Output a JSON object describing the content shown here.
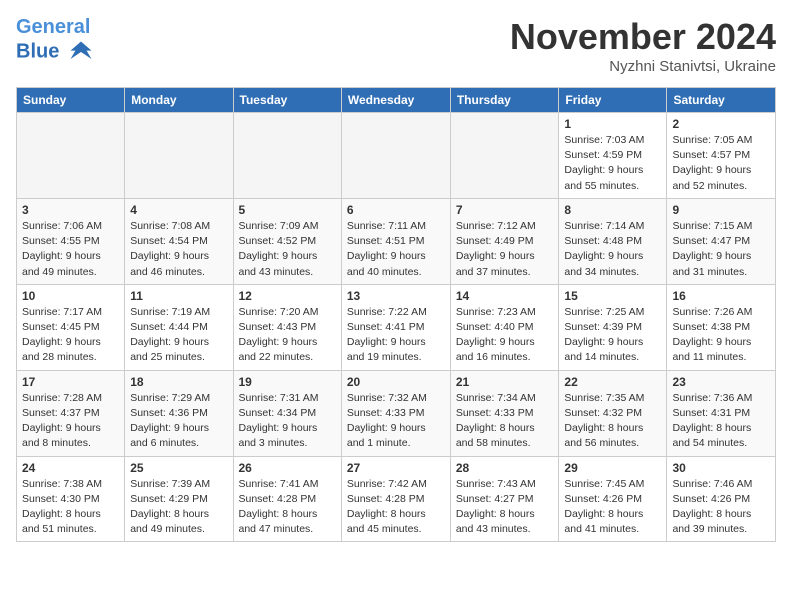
{
  "logo": {
    "line1": "General",
    "line2": "Blue"
  },
  "title": "November 2024",
  "subtitle": "Nyzhni Stanivtsi, Ukraine",
  "days_header": [
    "Sunday",
    "Monday",
    "Tuesday",
    "Wednesday",
    "Thursday",
    "Friday",
    "Saturday"
  ],
  "weeks": [
    [
      {
        "num": "",
        "empty": true
      },
      {
        "num": "",
        "empty": true
      },
      {
        "num": "",
        "empty": true
      },
      {
        "num": "",
        "empty": true
      },
      {
        "num": "",
        "empty": true
      },
      {
        "num": "1",
        "info": "Sunrise: 7:03 AM\nSunset: 4:59 PM\nDaylight: 9 hours\nand 55 minutes."
      },
      {
        "num": "2",
        "info": "Sunrise: 7:05 AM\nSunset: 4:57 PM\nDaylight: 9 hours\nand 52 minutes."
      }
    ],
    [
      {
        "num": "3",
        "info": "Sunrise: 7:06 AM\nSunset: 4:55 PM\nDaylight: 9 hours\nand 49 minutes."
      },
      {
        "num": "4",
        "info": "Sunrise: 7:08 AM\nSunset: 4:54 PM\nDaylight: 9 hours\nand 46 minutes."
      },
      {
        "num": "5",
        "info": "Sunrise: 7:09 AM\nSunset: 4:52 PM\nDaylight: 9 hours\nand 43 minutes."
      },
      {
        "num": "6",
        "info": "Sunrise: 7:11 AM\nSunset: 4:51 PM\nDaylight: 9 hours\nand 40 minutes."
      },
      {
        "num": "7",
        "info": "Sunrise: 7:12 AM\nSunset: 4:49 PM\nDaylight: 9 hours\nand 37 minutes."
      },
      {
        "num": "8",
        "info": "Sunrise: 7:14 AM\nSunset: 4:48 PM\nDaylight: 9 hours\nand 34 minutes."
      },
      {
        "num": "9",
        "info": "Sunrise: 7:15 AM\nSunset: 4:47 PM\nDaylight: 9 hours\nand 31 minutes."
      }
    ],
    [
      {
        "num": "10",
        "info": "Sunrise: 7:17 AM\nSunset: 4:45 PM\nDaylight: 9 hours\nand 28 minutes."
      },
      {
        "num": "11",
        "info": "Sunrise: 7:19 AM\nSunset: 4:44 PM\nDaylight: 9 hours\nand 25 minutes."
      },
      {
        "num": "12",
        "info": "Sunrise: 7:20 AM\nSunset: 4:43 PM\nDaylight: 9 hours\nand 22 minutes."
      },
      {
        "num": "13",
        "info": "Sunrise: 7:22 AM\nSunset: 4:41 PM\nDaylight: 9 hours\nand 19 minutes."
      },
      {
        "num": "14",
        "info": "Sunrise: 7:23 AM\nSunset: 4:40 PM\nDaylight: 9 hours\nand 16 minutes."
      },
      {
        "num": "15",
        "info": "Sunrise: 7:25 AM\nSunset: 4:39 PM\nDaylight: 9 hours\nand 14 minutes."
      },
      {
        "num": "16",
        "info": "Sunrise: 7:26 AM\nSunset: 4:38 PM\nDaylight: 9 hours\nand 11 minutes."
      }
    ],
    [
      {
        "num": "17",
        "info": "Sunrise: 7:28 AM\nSunset: 4:37 PM\nDaylight: 9 hours\nand 8 minutes."
      },
      {
        "num": "18",
        "info": "Sunrise: 7:29 AM\nSunset: 4:36 PM\nDaylight: 9 hours\nand 6 minutes."
      },
      {
        "num": "19",
        "info": "Sunrise: 7:31 AM\nSunset: 4:34 PM\nDaylight: 9 hours\nand 3 minutes."
      },
      {
        "num": "20",
        "info": "Sunrise: 7:32 AM\nSunset: 4:33 PM\nDaylight: 9 hours\nand 1 minute."
      },
      {
        "num": "21",
        "info": "Sunrise: 7:34 AM\nSunset: 4:33 PM\nDaylight: 8 hours\nand 58 minutes."
      },
      {
        "num": "22",
        "info": "Sunrise: 7:35 AM\nSunset: 4:32 PM\nDaylight: 8 hours\nand 56 minutes."
      },
      {
        "num": "23",
        "info": "Sunrise: 7:36 AM\nSunset: 4:31 PM\nDaylight: 8 hours\nand 54 minutes."
      }
    ],
    [
      {
        "num": "24",
        "info": "Sunrise: 7:38 AM\nSunset: 4:30 PM\nDaylight: 8 hours\nand 51 minutes."
      },
      {
        "num": "25",
        "info": "Sunrise: 7:39 AM\nSunset: 4:29 PM\nDaylight: 8 hours\nand 49 minutes."
      },
      {
        "num": "26",
        "info": "Sunrise: 7:41 AM\nSunset: 4:28 PM\nDaylight: 8 hours\nand 47 minutes."
      },
      {
        "num": "27",
        "info": "Sunrise: 7:42 AM\nSunset: 4:28 PM\nDaylight: 8 hours\nand 45 minutes."
      },
      {
        "num": "28",
        "info": "Sunrise: 7:43 AM\nSunset: 4:27 PM\nDaylight: 8 hours\nand 43 minutes."
      },
      {
        "num": "29",
        "info": "Sunrise: 7:45 AM\nSunset: 4:26 PM\nDaylight: 8 hours\nand 41 minutes."
      },
      {
        "num": "30",
        "info": "Sunrise: 7:46 AM\nSunset: 4:26 PM\nDaylight: 8 hours\nand 39 minutes."
      }
    ]
  ]
}
